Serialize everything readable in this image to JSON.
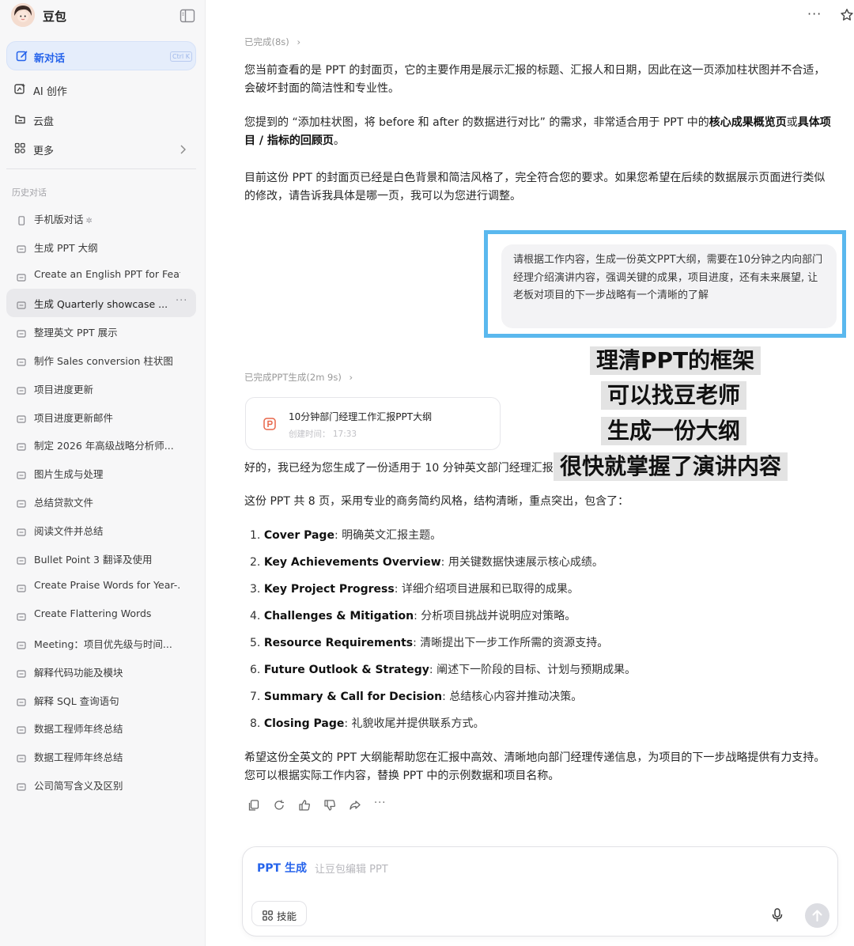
{
  "sidebar": {
    "app_name": "豆包",
    "new_chat": {
      "label": "新对话",
      "shortcut": "Ctrl K"
    },
    "nav": [
      {
        "label": "AI 创作",
        "icon": "ai-create-icon"
      },
      {
        "label": "云盘",
        "icon": "cloud-drive-icon"
      },
      {
        "label": "更多",
        "icon": "grid-more-icon"
      }
    ],
    "history_title": "历史对话",
    "history": [
      {
        "label": "手机版对话",
        "icon": "phone-icon",
        "pinned": true
      },
      {
        "label": "生成 PPT 大纲"
      },
      {
        "label": "Create an English PPT for Feat..."
      },
      {
        "label": "生成 Quarterly showcase ...",
        "active": true
      },
      {
        "label": "整理英文 PPT 展示"
      },
      {
        "label": "制作 Sales conversion 柱状图"
      },
      {
        "label": "项目进度更新"
      },
      {
        "label": "项目进度更新邮件"
      },
      {
        "label": "制定 2026 年高级战略分析师..."
      },
      {
        "label": "图片生成与处理"
      },
      {
        "label": "总结贷款文件"
      },
      {
        "label": "阅读文件并总结"
      },
      {
        "label": "Bullet Point 3 翻译及使用"
      },
      {
        "label": "Create Praise Words for Year-..."
      },
      {
        "label": "Create Flattering Words"
      },
      {
        "label": "Meeting：项目优先级与时间..."
      },
      {
        "label": "解释代码功能及模块"
      },
      {
        "label": "解释 SQL 查询语句"
      },
      {
        "label": "数据工程师年终总结"
      },
      {
        "label": "数据工程师年终总结"
      },
      {
        "label": "公司简写含义及区别"
      }
    ]
  },
  "main": {
    "status_1": "已完成(8s)",
    "para_1": "您当前查看的是 PPT 的封面页，它的主要作用是展示汇报的标题、汇报人和日期，因此在这一页添加柱状图并不合适，会破坏封面的简洁性和专业性。",
    "para_2_pre": "您提到的 “添加柱状图，将 before 和 after 的数据进行对比” 的需求，非常适合用于 PPT 中的",
    "para_2_bold1": "核心成果概览页",
    "para_2_mid": "或",
    "para_2_bold2": "具体项目 / 指标的回顾页",
    "para_2_end": "。",
    "para_3": "目前这份 PPT 的封面页已经是白色背景和简洁风格了，完全符合您的要求。如果您希望在后续的数据展示页面进行类似的修改，请告诉我具体是哪一页，我可以为您进行调整。",
    "user_message": "请根据工作内容，生成一份英文PPT大纲，需要在10分钟之内向部门经理介绍演讲内容，强调关键的成果，项目进度，还有未来展望, 让老板对项目的下一步战略有一个清晰的了解",
    "status_2": "已完成PPT生成(2m 9s)",
    "card": {
      "title": "10分钟部门经理工作汇报PPT大纲",
      "time_label": "创建时间：",
      "time": "17:33"
    },
    "para_4": "好的，我已经为您生成了一份适用于 10 分钟英文部门经理汇报的 PPT 大纲。",
    "para_5": "这份 PPT 共 8 页，采用专业的商务简约风格，结构清晰，重点突出，包含了：",
    "outline": [
      {
        "num": "1.",
        "title": "Cover Page",
        "desc": ": 明确英文汇报主题。"
      },
      {
        "num": "2.",
        "title": "Key Achievements Overview",
        "desc": ": 用关键数据快速展示核心成绩。"
      },
      {
        "num": "3.",
        "title": "Key Project Progress",
        "desc": ": 详细介绍项目进展和已取得的成果。"
      },
      {
        "num": "4.",
        "title": "Challenges & Mitigation",
        "desc": ": 分析项目挑战并说明应对策略。"
      },
      {
        "num": "5.",
        "title": "Resource Requirements",
        "desc": ": 清晰提出下一步工作所需的资源支持。"
      },
      {
        "num": "6.",
        "title": "Future Outlook & Strategy",
        "desc": ": 阐述下一阶段的目标、计划与预期成果。"
      },
      {
        "num": "7.",
        "title": "Summary & Call for Decision",
        "desc": ": 总结核心内容并推动决策。"
      },
      {
        "num": "8.",
        "title": "Closing Page",
        "desc": ": 礼貌收尾并提供联系方式。"
      }
    ],
    "para_6": "希望这份全英文的 PPT 大纲能帮助您在汇报中高效、清晰地向部门经理传递信息，为项目的下一步战略提供有力支持。您可以根据实际工作内容，替换 PPT 中的示例数据和项目名称。",
    "overlays": [
      "理清PPT的框架",
      "可以找豆老师",
      "生成一份大纲",
      "很快就掌握了演讲内容"
    ]
  },
  "input": {
    "mode": "PPT 生成",
    "placeholder": "让豆包编辑 PPT",
    "skill_label": "技能"
  },
  "colors": {
    "accent": "#2563eb",
    "highlight_border": "#5ab8ee"
  }
}
